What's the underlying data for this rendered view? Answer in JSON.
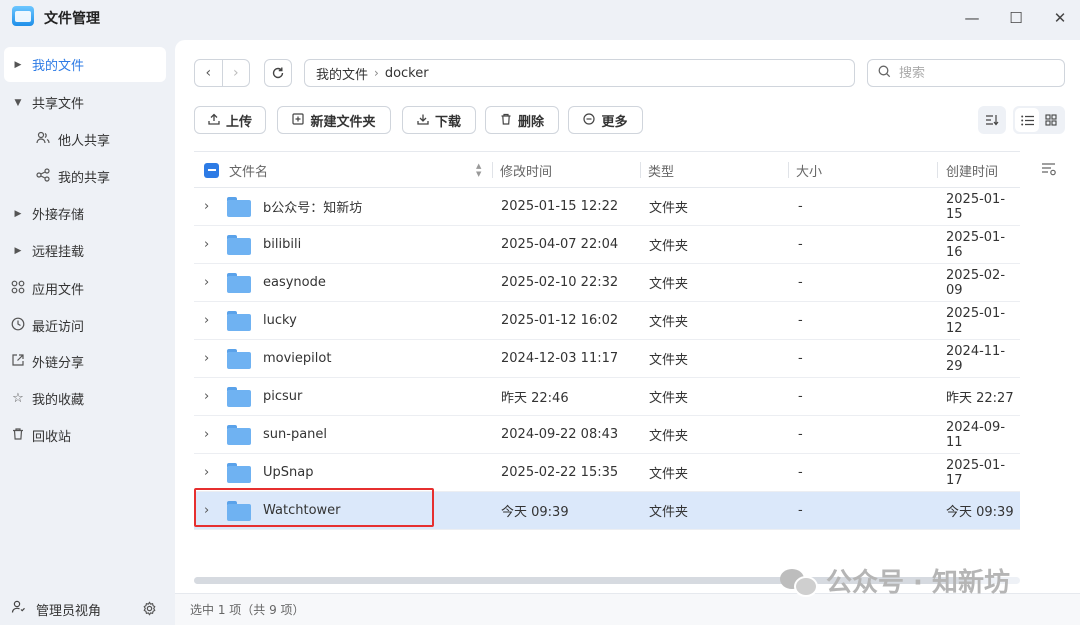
{
  "app": {
    "title": "文件管理"
  },
  "window": {
    "minimize": "—",
    "maximize": "☐",
    "close": "✕"
  },
  "sidebar": {
    "items": [
      {
        "label": "我的文件",
        "icon": "caret-right",
        "active": true
      },
      {
        "label": "共享文件",
        "icon": "caret-down"
      },
      {
        "label": "他人共享",
        "icon": "users-icon",
        "sub": true
      },
      {
        "label": "我的共享",
        "icon": "share-icon",
        "sub": true
      },
      {
        "label": "外接存储",
        "icon": "caret-right"
      },
      {
        "label": "远程挂载",
        "icon": "caret-right"
      },
      {
        "label": "应用文件",
        "icon": "apps-icon"
      },
      {
        "label": "最近访问",
        "icon": "clock-icon"
      },
      {
        "label": "外链分享",
        "icon": "external-link-icon"
      },
      {
        "label": "我的收藏",
        "icon": "star-icon"
      },
      {
        "label": "回收站",
        "icon": "trash-icon"
      }
    ],
    "footer": {
      "label": "管理员视角"
    }
  },
  "path": {
    "root": "我的文件",
    "current": "docker"
  },
  "search": {
    "placeholder": "搜索"
  },
  "toolbar": {
    "upload": "上传",
    "new_folder": "新建文件夹",
    "download": "下载",
    "delete": "删除",
    "more": "更多"
  },
  "table": {
    "columns": {
      "name": "文件名",
      "modified": "修改时间",
      "type": "类型",
      "size": "大小",
      "created": "创建时间"
    },
    "rows": [
      {
        "name": "b公众号：知新坊",
        "modified": "2025-01-15 12:22",
        "type": "文件夹",
        "size": "-",
        "created": "2025-01-15"
      },
      {
        "name": "bilibili",
        "modified": "2025-04-07 22:04",
        "type": "文件夹",
        "size": "-",
        "created": "2025-01-16"
      },
      {
        "name": "easynode",
        "modified": "2025-02-10 22:32",
        "type": "文件夹",
        "size": "-",
        "created": "2025-02-09"
      },
      {
        "name": "lucky",
        "modified": "2025-01-12 16:02",
        "type": "文件夹",
        "size": "-",
        "created": "2025-01-12"
      },
      {
        "name": "moviepilot",
        "modified": "2024-12-03 11:17",
        "type": "文件夹",
        "size": "-",
        "created": "2024-11-29"
      },
      {
        "name": "picsur",
        "modified": "昨天 22:46",
        "type": "文件夹",
        "size": "-",
        "created": "昨天 22:27"
      },
      {
        "name": "sun-panel",
        "modified": "2024-09-22 08:43",
        "type": "文件夹",
        "size": "-",
        "created": "2024-09-11"
      },
      {
        "name": "UpSnap",
        "modified": "2025-02-22 15:35",
        "type": "文件夹",
        "size": "-",
        "created": "2025-01-17"
      },
      {
        "name": "Watchtower",
        "modified": "今天 09:39",
        "type": "文件夹",
        "size": "-",
        "created": "今天 09:39",
        "selected": true
      }
    ]
  },
  "status": {
    "text": "选中 1 项（共 9 项）"
  },
  "watermark": {
    "text": "公众号 · 知新坊"
  },
  "colors": {
    "accent": "#2d7be5",
    "selected_row": "#dbe8fa",
    "highlight_border": "#e62f2f"
  }
}
